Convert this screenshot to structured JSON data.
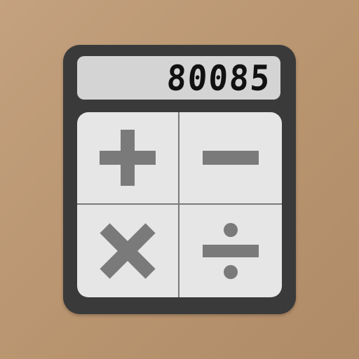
{
  "display": {
    "value": "80085"
  },
  "keys": [
    {
      "op": "add",
      "icon": "plus-icon"
    },
    {
      "op": "subtract",
      "icon": "minus-icon"
    },
    {
      "op": "multiply",
      "icon": "multiply-icon"
    },
    {
      "op": "divide",
      "icon": "divide-icon"
    }
  ],
  "colors": {
    "background": "#b8946f",
    "body": "#3a3a3a",
    "display": "#d4d4d4",
    "keypad": "#e6e6e6",
    "symbol": "#7a7a7a"
  }
}
